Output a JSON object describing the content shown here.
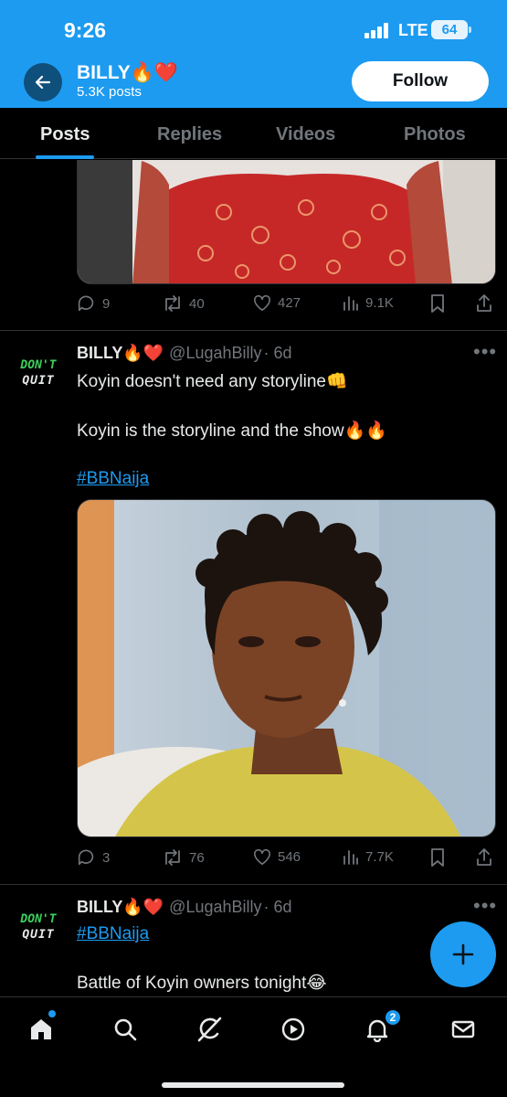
{
  "status_bar": {
    "time": "9:26",
    "network": "LTE",
    "battery": "64"
  },
  "header": {
    "name": "BILLY🔥❤️",
    "posts_count": "5.3K posts",
    "follow_label": "Follow"
  },
  "tabs": [
    {
      "label": "Posts",
      "active": true
    },
    {
      "label": "Replies",
      "active": false
    },
    {
      "label": "Videos",
      "active": false
    },
    {
      "label": "Photos",
      "active": false
    }
  ],
  "avatar": {
    "line1": "DON'T",
    "line2": "QUIT"
  },
  "posts": [
    {
      "media_desc": "cropped photo of person in red patterned outfit",
      "stats": {
        "replies": "9",
        "reposts": "40",
        "likes": "427",
        "views": "9.1K"
      }
    },
    {
      "name": "BILLY🔥❤️",
      "handle": "@LugahBilly",
      "time": "· 6d",
      "lines": [
        "Koyin doesn't need any storyline👊",
        "Koyin is the storyline and the show🔥🔥"
      ],
      "hashtag": "#BBNaija",
      "stats": {
        "replies": "3",
        "reposts": "76",
        "likes": "546",
        "views": "7.7K"
      }
    },
    {
      "name": "BILLY🔥❤️",
      "handle": "@LugahBilly",
      "time": "· 6d",
      "hashtag": "#BBNaija",
      "lines": [
        "Battle of Koyin owners tonight😂"
      ]
    }
  ],
  "bottom_nav": {
    "notifications_badge": "2"
  },
  "icons": [
    "back-arrow-icon",
    "more-icon",
    "reply-icon",
    "repost-icon",
    "like-icon",
    "views-icon",
    "bookmark-icon",
    "share-icon",
    "home-icon",
    "search-icon",
    "grok-icon",
    "video-icon",
    "bell-icon",
    "mail-icon",
    "plus-icon"
  ],
  "colors": {
    "accent": "#1d9bf0",
    "background": "#000000",
    "muted": "#71767b"
  }
}
